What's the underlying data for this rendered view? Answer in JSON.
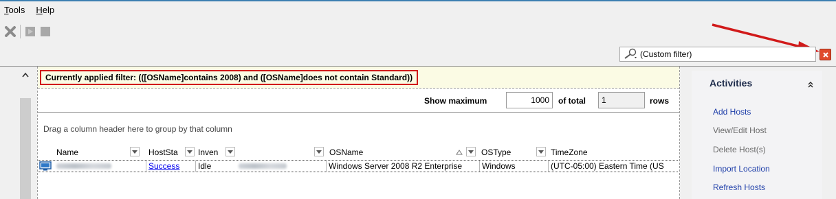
{
  "menu": {
    "items": [
      {
        "label_first": "T",
        "label_rest": "ools"
      },
      {
        "label_first": "H",
        "label_rest": "elp"
      }
    ]
  },
  "toolbar": {
    "icons": [
      "close-x-icon",
      "play-icon",
      "stop-icon"
    ]
  },
  "filter": {
    "value": "(Custom filter)",
    "applied_text": "Currently applied filter:  (([OSName]contains 2008) and ([OSName]does not contain Standard))"
  },
  "rows_bar": {
    "show_maximum_label": "Show maximum",
    "maximum_value": "1000",
    "of_total_label": "of total",
    "total_value": "1",
    "rows_label": "rows"
  },
  "grid": {
    "group_hint": "Drag a column header here to group by that column",
    "columns": [
      "Name",
      "HostSta",
      "Inven",
      "",
      "OSName",
      "OSType",
      "TimeZone"
    ],
    "rows": [
      {
        "name": "",
        "host_status": "Success",
        "inventory": "Idle",
        "col4": "",
        "os_name": "Windows Server 2008 R2 Enterprise",
        "os_type": "Windows",
        "time_zone": "(UTC-05:00) Eastern Time (US"
      }
    ]
  },
  "activities": {
    "title": "Activities",
    "items": [
      {
        "label": "Add Hosts",
        "enabled": true
      },
      {
        "label": "View/Edit Host",
        "enabled": false
      },
      {
        "label": "Delete Host(s)",
        "enabled": false
      },
      {
        "label": "Import Location",
        "enabled": true
      },
      {
        "label": "Refresh Hosts",
        "enabled": true
      }
    ]
  },
  "colors": {
    "annotation_red": "#d11a1a",
    "link_blue": "#1f3fa9",
    "filter_banner_bg": "#fbfbe4"
  }
}
